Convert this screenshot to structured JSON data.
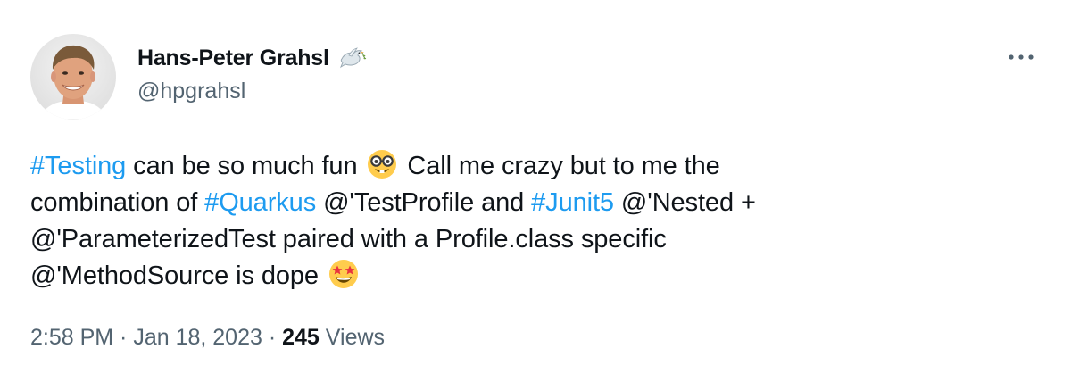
{
  "author": {
    "display_name": "Hans-Peter Grahsl",
    "handle": "@hpgrahsl",
    "badge_icon": "dove-icon",
    "avatar_icon": "avatar"
  },
  "more_icon": "more-horizontal-icon",
  "tweet": {
    "line1": {
      "hashtag_testing": "#Testing",
      "text_a": " can be so much fun ",
      "emoji_a": "nerd-face-emoji",
      "text_b": " Call me crazy but to me the"
    },
    "line2": {
      "text_a": "combination of ",
      "hashtag_quarkus": "#Quarkus",
      "text_b": " @'TestProfile and ",
      "hashtag_junit5": "#Junit5",
      "text_c": " @'Nested +"
    },
    "line3": {
      "text": "@'ParameterizedTest paired with a Profile.class specific"
    },
    "line4": {
      "text": "@'MethodSource is dope ",
      "emoji_b": "star-struck-emoji"
    }
  },
  "meta": {
    "time": "2:58 PM",
    "separator": " · ",
    "date": "Jan 18, 2023",
    "views_count": "245",
    "views_label": " Views"
  },
  "colors": {
    "link": "#1d9bf0",
    "secondary": "#536471",
    "primary": "#0f1419"
  }
}
